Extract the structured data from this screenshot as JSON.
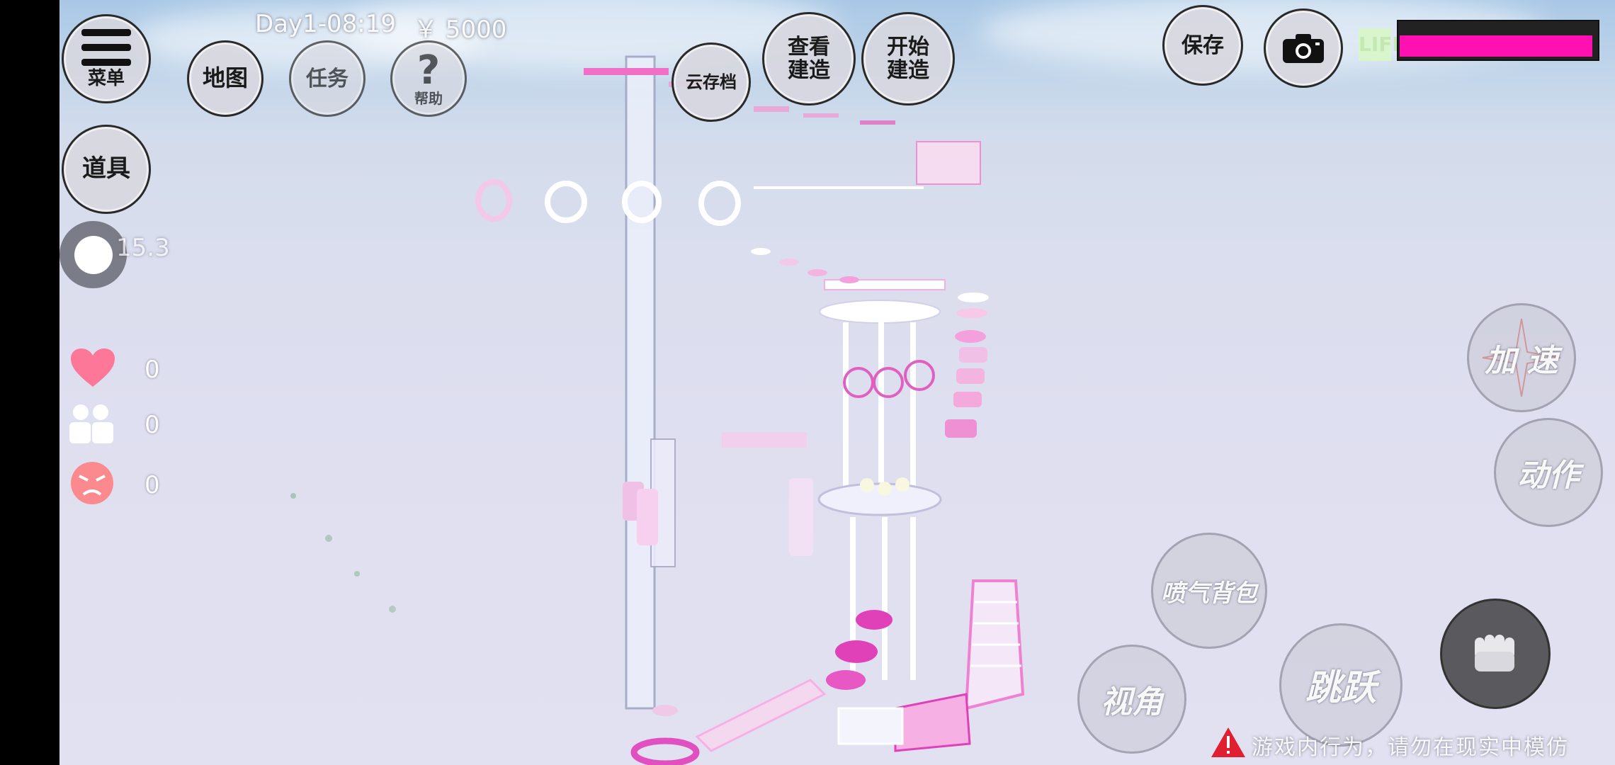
{
  "status": {
    "day_time": "Day1-08:19",
    "money": "￥ 5000",
    "speed": "15.3",
    "life_label": "LIFE",
    "life_value": 0.98
  },
  "menu": {
    "menu_label": "菜单",
    "map_label": "地图",
    "task_label": "任务",
    "help_label": "帮助",
    "help_glyph": "?",
    "items_label": "道具",
    "cloud_save_label": "云存档",
    "view_build_label": "查看\n建造",
    "start_build_label": "开始\n建造",
    "save_label": "保存"
  },
  "stats": {
    "hearts": "0",
    "friends": "0",
    "anger": "0"
  },
  "controls": {
    "accelerate": "加 速",
    "action": "动作",
    "jetpack": "喷气背包",
    "camera_angle": "视角",
    "jump": "跳跃"
  },
  "warning": {
    "text": "游戏内行为，请勿在现实中模仿"
  },
  "colors": {
    "accent_pink": "#ff10b0",
    "life_bg": "#222222",
    "sky": "#c3d6ea"
  }
}
